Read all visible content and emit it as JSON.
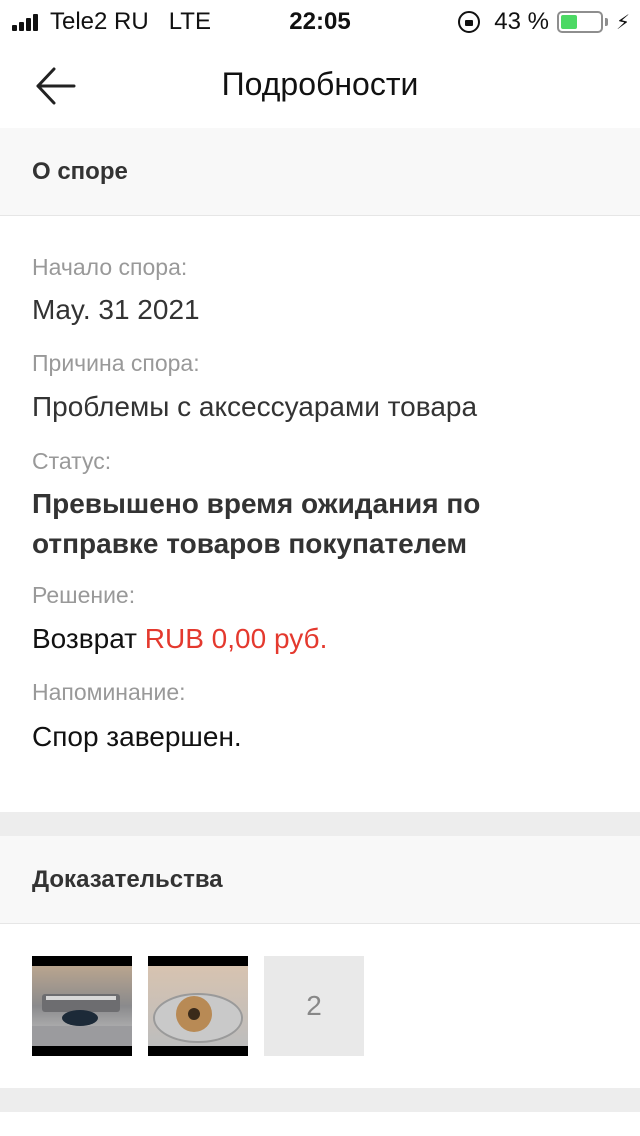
{
  "status_bar": {
    "carrier": "Tele2 RU",
    "network": "LTE",
    "time": "22:05",
    "battery_percent": "43 %",
    "battery_level": 0.43,
    "battery_color": "#4cd964"
  },
  "nav": {
    "title": "Подробности",
    "back_icon": "arrow-left-icon"
  },
  "about_section": {
    "header": "О споре",
    "start_label": "Начало спора:",
    "start_value": "May. 31 2021",
    "reason_label": "Причина спора:",
    "reason_value": "Проблемы с аксессуарами товара",
    "status_label": "Статус:",
    "status_value": "Превышено время ожидания по отправке товаров покупателем",
    "decision_label": "Решение:",
    "decision_prefix": "Возврат",
    "decision_amount": "RUB 0,00 руб.",
    "reminder_label": "Напоминание:",
    "reminder_value": "Спор завершен."
  },
  "evidence_section": {
    "header": "Доказательства",
    "more_count": "2"
  },
  "colors": {
    "accent_red": "#e4392e",
    "section_bg": "#f8f8f8",
    "separator": "#ededed"
  }
}
